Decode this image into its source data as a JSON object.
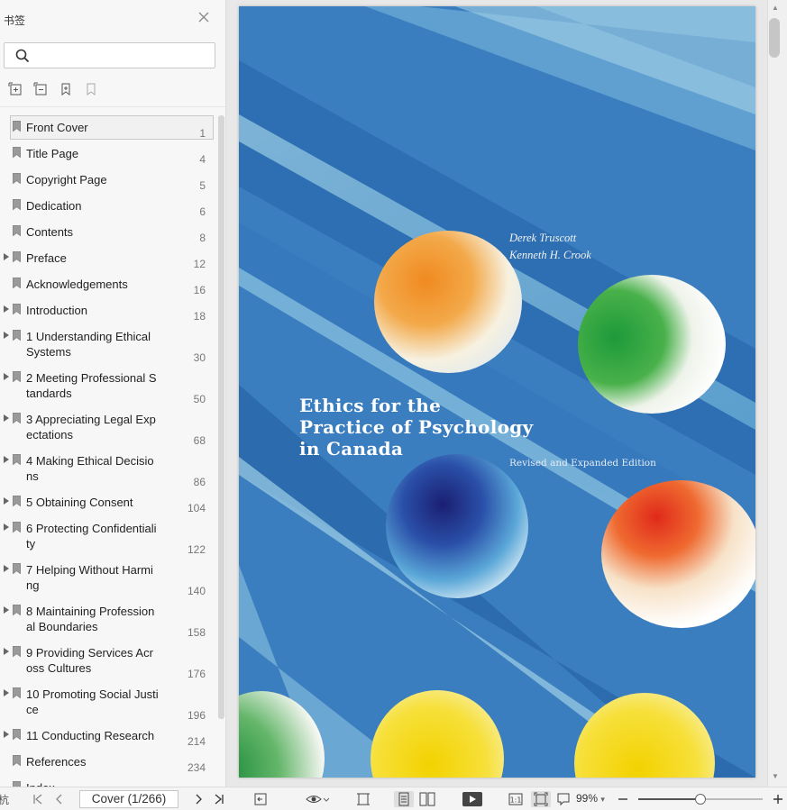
{
  "sidebar": {
    "title": "书签",
    "search_placeholder": "",
    "tools": [
      "expand-all-icon",
      "collapse-all-icon",
      "add-bookmark-icon",
      "remove-bookmark-icon"
    ],
    "items": [
      {
        "label": "Front Cover",
        "page": "1",
        "expandable": false,
        "selected": true
      },
      {
        "label": "Title Page",
        "page": "4",
        "expandable": false
      },
      {
        "label": "Copyright Page",
        "page": "5",
        "expandable": false
      },
      {
        "label": "Dedication",
        "page": "6",
        "expandable": false
      },
      {
        "label": "Contents",
        "page": "8",
        "expandable": false
      },
      {
        "label": "Preface",
        "page": "12",
        "expandable": true
      },
      {
        "label": "Acknowledgements",
        "page": "16",
        "expandable": false
      },
      {
        "label": "Introduction",
        "page": "18",
        "expandable": true
      },
      {
        "label": "1 Understanding Ethical\nSystems",
        "page": "30",
        "expandable": true
      },
      {
        "label": "2 Meeting Professional S\ntandards",
        "page": "50",
        "expandable": true
      },
      {
        "label": "3 Appreciating Legal Exp\nectations",
        "page": "68",
        "expandable": true
      },
      {
        "label": "4 Making Ethical Decisio\nns",
        "page": "86",
        "expandable": true
      },
      {
        "label": "5 Obtaining Consent",
        "page": "104",
        "expandable": true
      },
      {
        "label": "6 Protecting Confidentiali\nty",
        "page": "122",
        "expandable": true
      },
      {
        "label": "7 Helping Without Harmi\nng",
        "page": "140",
        "expandable": true
      },
      {
        "label": "8 Maintaining Profession\nal Boundaries",
        "page": "158",
        "expandable": true
      },
      {
        "label": "9 Providing Services Acr\noss Cultures",
        "page": "176",
        "expandable": true
      },
      {
        "label": "10 Promoting Social Justi\nce",
        "page": "196",
        "expandable": true
      },
      {
        "label": "11 Conducting Research",
        "page": "214",
        "expandable": true
      },
      {
        "label": "References",
        "page": "234",
        "expandable": false
      },
      {
        "label": "Index",
        "page": "",
        "expandable": false
      }
    ]
  },
  "cover": {
    "authors": [
      "Derek Truscott",
      "Kenneth H. Crook"
    ],
    "title": "Ethics for the\nPractice of Psychology\nin Canada",
    "edition": "Revised and Expanded Edition"
  },
  "toolbar": {
    "left_edge": "杭",
    "page_indicator": "Cover (1/266)",
    "zoom": "99%",
    "zoom_fraction": 0.5
  },
  "colors": {
    "cover_bg": "#3f7fc0",
    "accent": "#2f6eb0"
  }
}
